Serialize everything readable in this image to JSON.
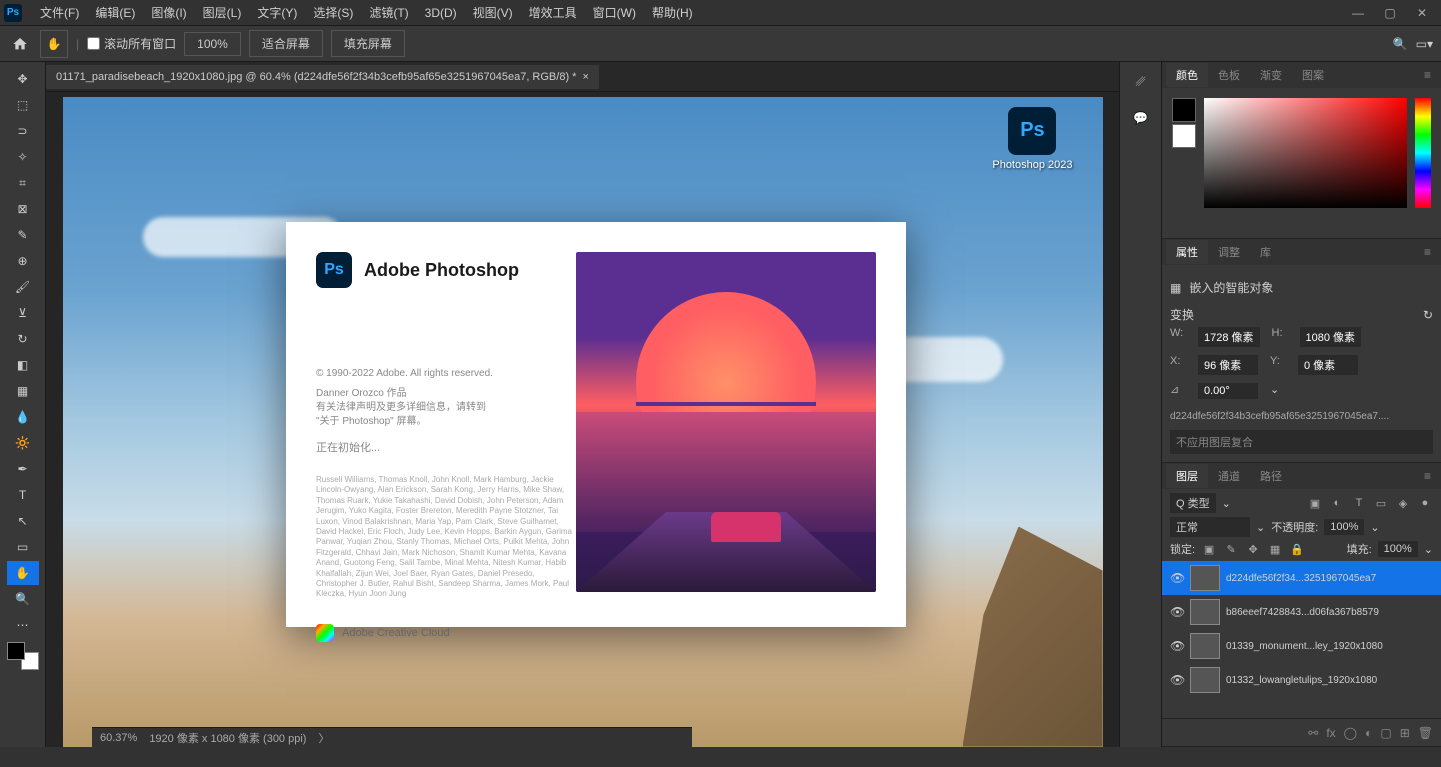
{
  "menu": {
    "items": [
      "文件(F)",
      "编辑(E)",
      "图像(I)",
      "图层(L)",
      "文字(Y)",
      "选择(S)",
      "滤镜(T)",
      "3D(D)",
      "视图(V)",
      "增效工具",
      "窗口(W)",
      "帮助(H)"
    ]
  },
  "optbar": {
    "scroll_all": "滚动所有窗口",
    "zoom": "100%",
    "fit_screen": "适合屏幕",
    "fill_screen": "填充屏幕"
  },
  "doc": {
    "tab": "01171_paradisebeach_1920x1080.jpg @ 60.4% (d224dfe56f2f34b3cefb95af65e3251967045ea7, RGB/8) *"
  },
  "shortcut": {
    "label": "Photoshop 2023"
  },
  "splash": {
    "title": "Adobe Photoshop",
    "copyright": "© 1990-2022 Adobe. All rights reserved.",
    "author": "Danner Orozco 作品",
    "legal": "有关法律声明及更多详细信息，请转到\n\"关于 Photoshop\" 屏幕。",
    "loading": "正在初始化...",
    "credits": "Russell Williams, Thomas Knoll, John Knoll, Mark Hamburg, Jackie Lincoln-Owyang, Alan Erickson, Sarah Kong, Jerry Harris, Mike Shaw, Thomas Ruark, Yukie Takahashi, David Dobish, John Peterson, Adam Jerugim, Yuko Kagita, Foster Brereton, Meredith Payne Stotzner, Tai Luxon, Vinod Balakrishnan, Maria Yap, Pam Clark, Steve Guilhamet, David Hackel, Eric Floch, Judy Lee, Kevin Hopps, Barkin Aygun, Garima Panwar, Yuqian Zhou, Stanly Thomas, Michael Orts, Pulkit Mehta, John Fitzgerald, Chhavi Jain, Mark Nichoson, Shamit Kumar Mehta, Kavana Anand, Guotong Feng, Salil Tambe, Minal Mehta, Nitesh Kumar, Habib Khalfallah, Zijun Wei, Joel Baer, Ryan Gates, Daniel Presedo, Christopher J. Butler, Rahul Bisht, Sandeep Sharma, James Mork, Paul Kleczka, Hyun Joon Jung",
    "cc": "Adobe Creative Cloud"
  },
  "panels": {
    "color": {
      "tabs": [
        "颜色",
        "色板",
        "渐变",
        "图案"
      ]
    },
    "props": {
      "tabs": [
        "属性",
        "调整",
        "库"
      ],
      "smartobj": "嵌入的智能对象",
      "transform": "变换",
      "w": "1728 像素",
      "h": "1080 像素",
      "x": "96 像素",
      "y": "0 像素",
      "angle": "0.00°",
      "smartname": "d224dfe56f2f34b3cefb95af65e3251967045ea7....",
      "nocomp": "不应用图层复合"
    },
    "layers": {
      "tabs": [
        "图层",
        "通道",
        "路径"
      ],
      "kind": "Q 类型",
      "blend": "正常",
      "opacity_label": "不透明度:",
      "opacity": "100%",
      "lock_label": "锁定:",
      "fill_label": "填充:",
      "fill": "100%",
      "items": [
        {
          "name": "d224dfe56f2f34...3251967045ea7",
          "selected": true
        },
        {
          "name": "b86eeef7428843...d06fa367b8579"
        },
        {
          "name": "01339_monument...ley_1920x1080"
        },
        {
          "name": "01332_lowangletulips_1920x1080"
        }
      ]
    }
  },
  "status": {
    "zoom": "60.37%",
    "dims": "1920 像素 x 1080 像素 (300 ppi)"
  }
}
